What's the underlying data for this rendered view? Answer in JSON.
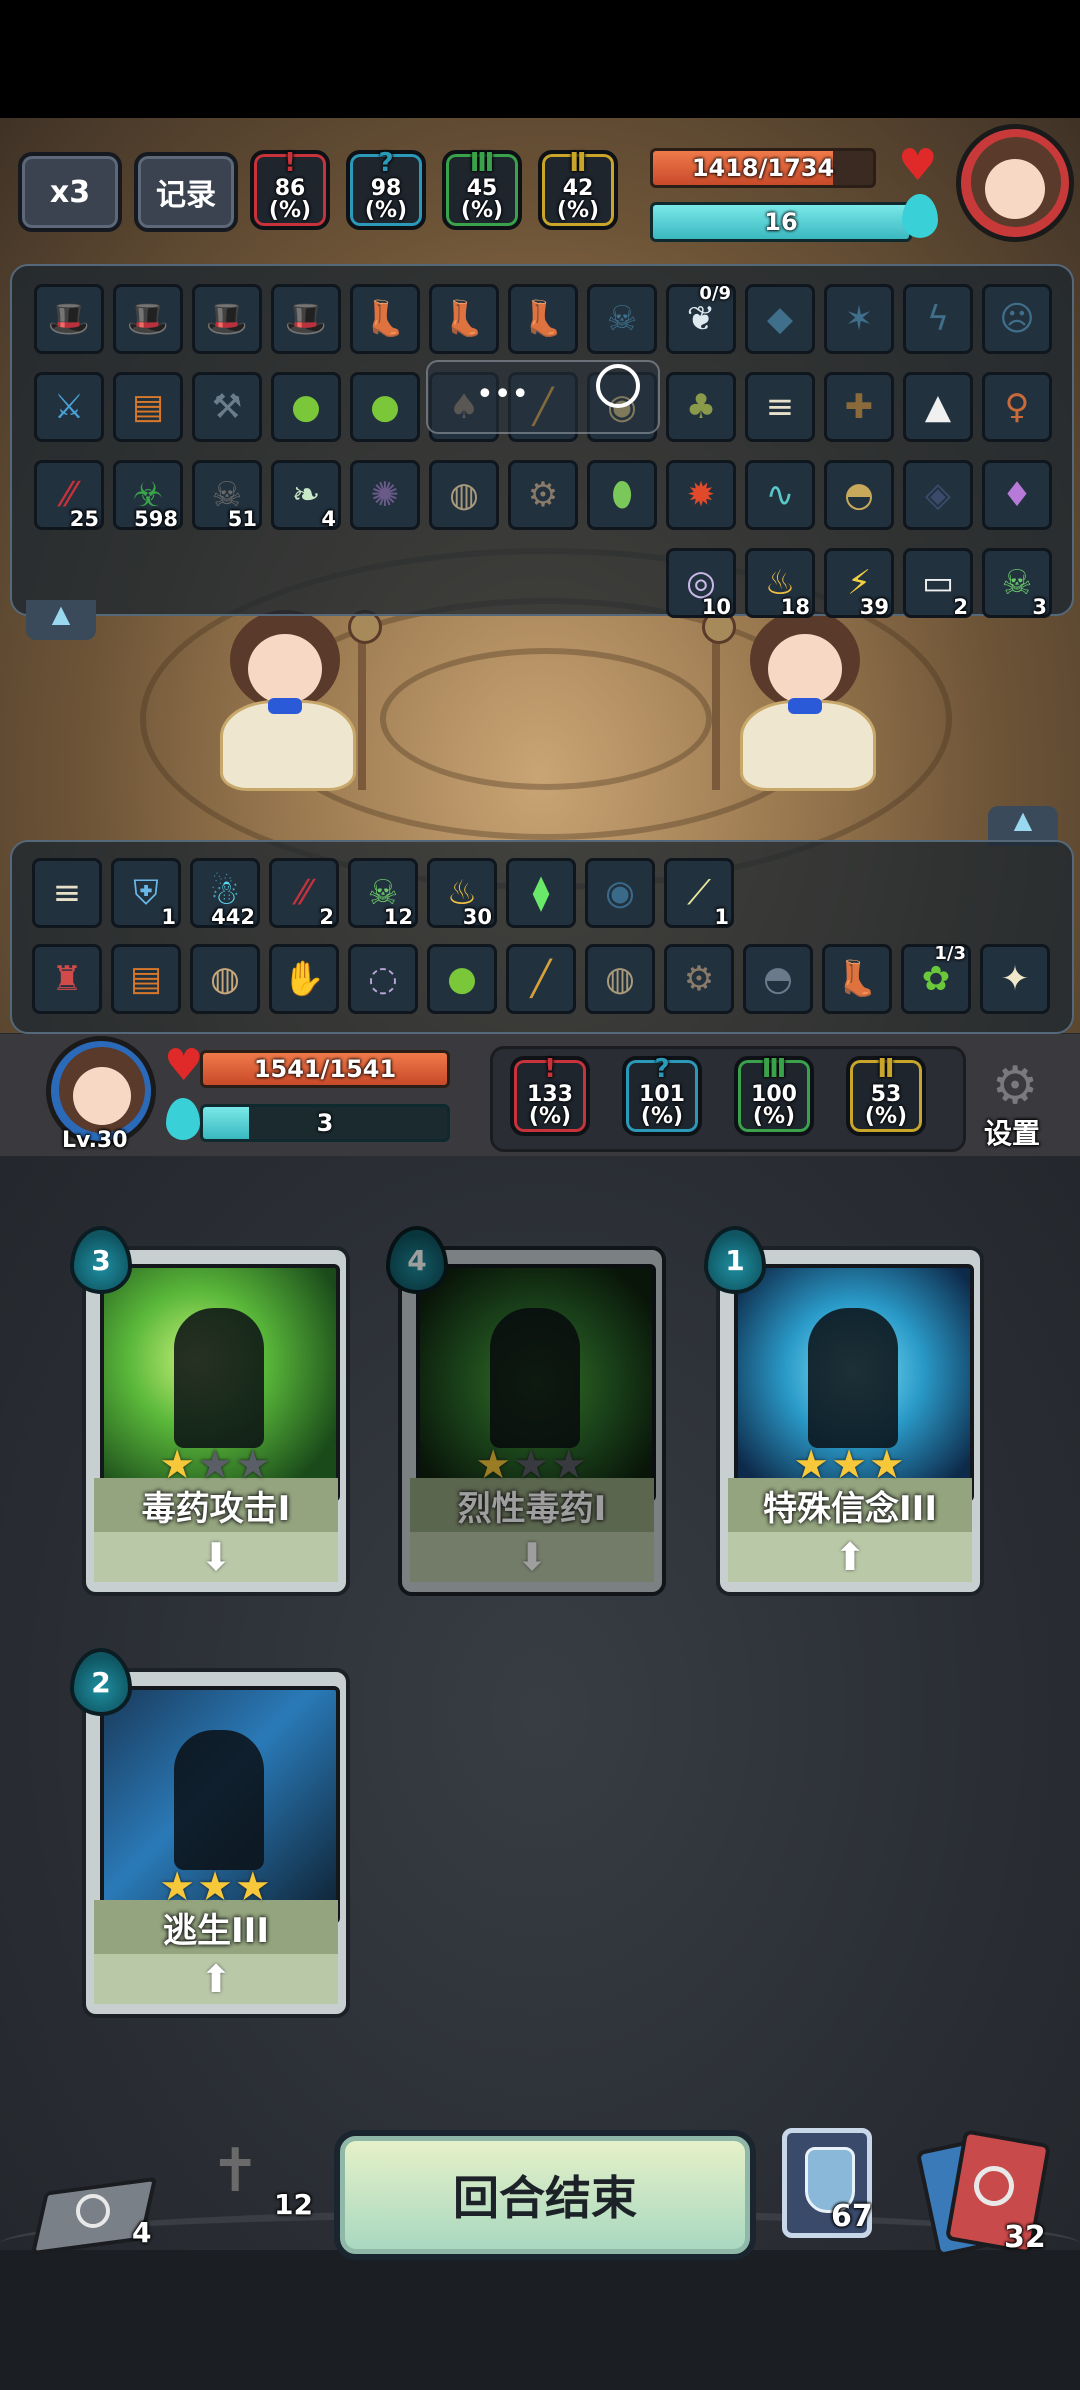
{
  "top": {
    "speed_label": "x3",
    "log_label": "记录",
    "enemy_stats": [
      {
        "value": "86",
        "unit": "(%)",
        "icon": "attack-icon",
        "color": "#c8323a"
      },
      {
        "value": "98",
        "unit": "(%)",
        "icon": "crit-icon",
        "color": "#2b9ab8"
      },
      {
        "value": "45",
        "unit": "(%)",
        "icon": "defense-icon",
        "color": "#3aa24a"
      },
      {
        "value": "42",
        "unit": "(%)",
        "icon": "speed-icon",
        "color": "#c9a62a"
      }
    ],
    "enemy_hp": "1418/1734",
    "enemy_hp_fraction": 0.818,
    "enemy_mana": "16",
    "enemy_mana_fraction": 1.0
  },
  "enemy_inventory": {
    "rows": [
      [
        {
          "icon": "hat-icon",
          "c": "#d24b4b"
        },
        {
          "icon": "hat-icon",
          "c": "#e07d2a"
        },
        {
          "icon": "hat-icon",
          "c": "#d24b4b"
        },
        {
          "icon": "hat-icon",
          "c": "#e07d2a"
        },
        {
          "icon": "boot-icon",
          "c": "#e07d2a"
        },
        {
          "icon": "boot-icon",
          "c": "#d24b4b"
        },
        {
          "icon": "boot-icon",
          "c": "#e07d2a"
        },
        {
          "icon": "demon-icon",
          "c": "#3f6f8a"
        },
        {
          "icon": "wing-icon",
          "c": "#dfeaf0",
          "top": "0/9"
        },
        {
          "icon": "crystal-icon",
          "c": "#3f6f8a"
        },
        {
          "icon": "claw-icon",
          "c": "#3f6f8a"
        },
        {
          "icon": "rune-icon",
          "c": "#3f6f8a"
        },
        {
          "icon": "face-icon",
          "c": "#3f6f8a"
        }
      ],
      [
        {
          "icon": "sword-icon",
          "c": "#4aa0d8"
        },
        {
          "icon": "book-icon",
          "c": "#d8782a"
        },
        {
          "icon": "hammer-icon",
          "c": "#6b7d8a"
        },
        {
          "icon": "slime-icon",
          "c": "#7ac83a"
        },
        {
          "icon": "slime-icon",
          "c": "#7ac83a"
        },
        {
          "icon": "bird-icon",
          "c": "#8a7a6a"
        },
        {
          "icon": "club-icon",
          "c": "#d8a23a"
        },
        {
          "icon": "orb-icon",
          "c": "#d8c07a"
        },
        {
          "icon": "toad-icon",
          "c": "#8a9a4a"
        },
        {
          "icon": "scroll-icon",
          "c": "#e8e0c8"
        },
        {
          "icon": "crossbow-icon",
          "c": "#8a6a3a"
        },
        {
          "icon": "rice-ball-icon",
          "c": "#f0f0f0"
        },
        {
          "icon": "doll-icon",
          "c": "#c86a3a"
        }
      ],
      [
        {
          "icon": "slash-icon",
          "c": "#c8323a",
          "n": "25"
        },
        {
          "icon": "poison-icon",
          "c": "#3aa24a",
          "n": "598"
        },
        {
          "icon": "skull-icon",
          "c": "#6a6a6a",
          "n": "51"
        },
        {
          "icon": "wing-card-icon",
          "c": "#c8e8c8",
          "n": "4"
        },
        {
          "icon": "sigil-icon",
          "c": "#6a5a8a"
        },
        {
          "icon": "shell-icon",
          "c": "#a89a7a"
        },
        {
          "icon": "gear-orb-icon",
          "c": "#8a7a6a"
        },
        {
          "icon": "egg-icon",
          "c": "#7ac85a"
        },
        {
          "icon": "fire-bird-icon",
          "c": "#e04a2a"
        },
        {
          "icon": "wind-icon",
          "c": "#5ac8c8"
        },
        {
          "icon": "helmet-icon",
          "c": "#c8a85a"
        },
        {
          "icon": "dark-gem-icon",
          "c": "#3a4a6a"
        },
        {
          "icon": "crystals-icon",
          "c": "#b87ad8"
        }
      ],
      [
        {
          "icon": "vortex-icon",
          "c": "#c8b8e8",
          "n": "10"
        },
        {
          "icon": "candle-icon",
          "c": "#f0c040",
          "n": "18"
        },
        {
          "icon": "lightning-icon",
          "c": "#f0d040",
          "n": "39"
        },
        {
          "icon": "paper-icon",
          "c": "#f0f0f0",
          "n": "2"
        },
        {
          "icon": "skull-green-icon",
          "c": "#6ac86a",
          "n": "3"
        }
      ]
    ]
  },
  "player_inventory": {
    "rows": [
      [
        {
          "icon": "scroll-icon",
          "c": "#e8e0c8"
        },
        {
          "icon": "shield-icon",
          "c": "#6ab8e8",
          "n": "1"
        },
        {
          "icon": "ice-face-icon",
          "c": "#5ad8f0",
          "n": "442"
        },
        {
          "icon": "slash-icon",
          "c": "#c8323a",
          "n": "2"
        },
        {
          "icon": "skull-green-icon",
          "c": "#6ac86a",
          "n": "12"
        },
        {
          "icon": "candle-icon",
          "c": "#f0c040",
          "n": "30"
        },
        {
          "icon": "green-shard-icon",
          "c": "#6ae86a"
        },
        {
          "icon": "dark-eye-icon",
          "c": "#3a6a8a"
        },
        {
          "icon": "blade-icon",
          "c": "#e8e8a0",
          "n": "1"
        }
      ],
      [
        {
          "icon": "robot-icon",
          "c": "#d24b4b"
        },
        {
          "icon": "book-icon",
          "c": "#d8782a"
        },
        {
          "icon": "shell-icon",
          "c": "#c8a87a"
        },
        {
          "icon": "glove-icon",
          "c": "#d24b4b"
        },
        {
          "icon": "ghost-orb-icon",
          "c": "#b8a8d8"
        },
        {
          "icon": "slime-icon",
          "c": "#7ac83a"
        },
        {
          "icon": "club-icon",
          "c": "#d8a23a"
        },
        {
          "icon": "shell-icon",
          "c": "#a89a7a"
        },
        {
          "icon": "gear-orb-icon",
          "c": "#8a7a6a"
        },
        {
          "icon": "helmet-icon",
          "c": "#6a7a8a"
        },
        {
          "icon": "boot-icon",
          "c": "#dfeaf0"
        },
        {
          "icon": "plant-icon",
          "c": "#6ac83a",
          "top": "1/3"
        },
        {
          "icon": "ice-cream-icon",
          "c": "#f0e8c8"
        }
      ]
    ]
  },
  "player": {
    "level": "Lv.30",
    "hp": "1541/1541",
    "hp_fraction": 1.0,
    "mana": "3",
    "mana_fraction": 0.19,
    "stats": [
      {
        "value": "133",
        "unit": "(%)",
        "icon": "attack-icon",
        "color": "#c8323a"
      },
      {
        "value": "101",
        "unit": "(%)",
        "icon": "crit-icon",
        "color": "#2b9ab8"
      },
      {
        "value": "100",
        "unit": "(%)",
        "icon": "defense-icon",
        "color": "#3aa24a"
      },
      {
        "value": "53",
        "unit": "(%)",
        "icon": "speed-icon",
        "color": "#c9a62a"
      }
    ],
    "settings_label": "设置"
  },
  "cards": [
    {
      "cost": "3",
      "name": "毒药攻击I",
      "stars": 1,
      "max_stars": 3,
      "arrow": "down",
      "dim": false,
      "art": "poison-attack-art"
    },
    {
      "cost": "4",
      "name": "烈性毒药I",
      "stars": 1,
      "max_stars": 3,
      "arrow": "down",
      "dim": true,
      "art": "strong-poison-art"
    },
    {
      "cost": "1",
      "name": "特殊信念III",
      "stars": 3,
      "max_stars": 3,
      "arrow": "up",
      "dim": false,
      "art": "special-faith-art"
    },
    {
      "cost": "2",
      "name": "逃生III",
      "stars": 3,
      "max_stars": 3,
      "arrow": "up",
      "dim": false,
      "art": "escape-art"
    }
  ],
  "bottom": {
    "end_turn_label": "回合结束",
    "discard_count": "4",
    "grave_count": "12",
    "potion_count": "67",
    "deck_count": "32"
  }
}
